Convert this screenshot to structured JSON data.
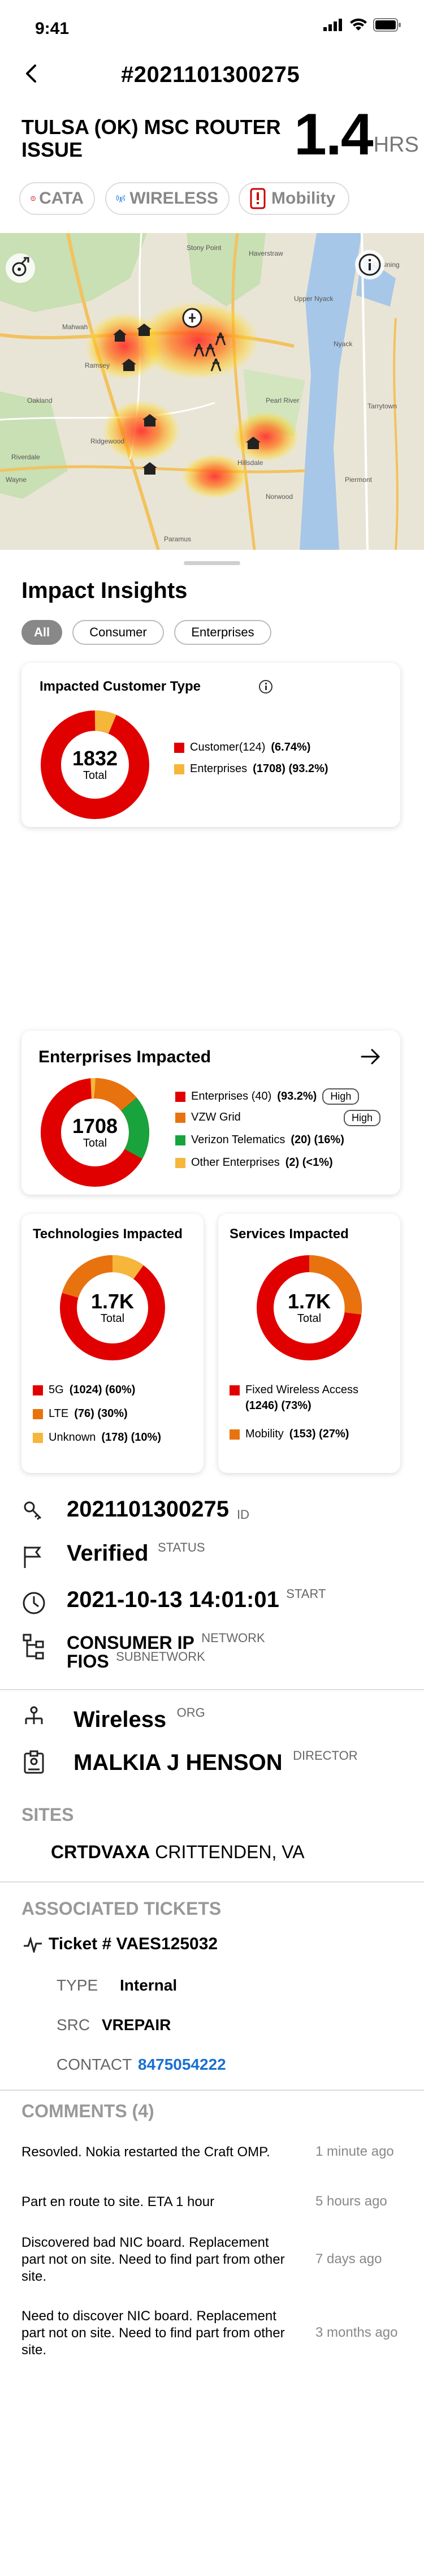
{
  "status_bar": {
    "time": "9:41"
  },
  "header": {
    "ticket_id": "#2021101300275"
  },
  "issue": {
    "title": "Tulsa (ok) MSC ROUTER ISSUE",
    "hours": "1.4",
    "hours_unit": "HRS"
  },
  "chips": [
    {
      "label": "CATA",
      "color": "#cc0000"
    },
    {
      "label": "WIRELESS",
      "color": "#1a73e8"
    },
    {
      "label": "Mobility",
      "color": "#cc0000"
    }
  ],
  "map": {
    "labels": [
      "Mahwah",
      "Ramsey",
      "Oakland",
      "Ridgewood",
      "Paramus",
      "Hillsdale",
      "Piermont",
      "Ossining",
      "Tarrytown",
      "Pearl River",
      "Nyack",
      "Wayne",
      "Riverdale",
      "Norwood",
      "Upper Nyack",
      "Haverstraw",
      "Stony Point"
    ]
  },
  "impact": {
    "title": "Impact Insights",
    "filters": [
      "All",
      "Consumer",
      "Enterprises"
    ],
    "customer_card": {
      "title": "Impacted Customer Type",
      "total": "1832",
      "total_label": "Total",
      "legend": [
        {
          "label": "Customer(124)",
          "value": "(6.74%)",
          "color": "#e00000"
        },
        {
          "label": "Enterprises",
          "value": "(1708) (93.2%)",
          "color": "#f5b63a"
        }
      ]
    },
    "enterprise_card": {
      "title": "Enterprises Impacted",
      "total": "1708",
      "total_label": "Total",
      "legend": [
        {
          "label": "Enterprises (40)",
          "value": "(93.2%)",
          "badge": "High",
          "color": "#e00000"
        },
        {
          "label": "VZW Grid",
          "value": "",
          "badge": "High",
          "color": "#e8730e"
        },
        {
          "label": "Verizon Telematics",
          "value": "(20) (16%)",
          "badge": "",
          "color": "#18a33c"
        },
        {
          "label": "Other Enterprises",
          "value": "(2) (<1%)",
          "badge": "",
          "color": "#f5b63a"
        }
      ]
    },
    "tech_card": {
      "title": "Technologies Impacted",
      "total": "1.7K",
      "total_label": "Total",
      "legend": [
        {
          "label": "5G",
          "value": "(1024) (60%)",
          "color": "#e00000"
        },
        {
          "label": "LTE",
          "value": "(76) (30%)",
          "color": "#e8730e"
        },
        {
          "label": "Unknown",
          "value": "(178) (10%)",
          "color": "#f5b63a"
        }
      ]
    },
    "services_card": {
      "title": "Services Impacted",
      "total": "1.7K",
      "total_label": "Total",
      "legend": [
        {
          "label": "Fixed Wireless Access",
          "value": "(1246) (73%)",
          "color": "#e00000"
        },
        {
          "label": "Mobility",
          "value": "(153) (27%)",
          "color": "#e8730e"
        }
      ]
    }
  },
  "details": {
    "id": "2021101300275",
    "id_label": "ID",
    "status": "Verified",
    "status_label": "STATUS",
    "start": "2021-10-13 14:01:01",
    "start_label": "START",
    "network": "CONSUMER IP",
    "network_label": "NETWORK",
    "subnetwork": "FIOS",
    "subnetwork_label": "SUBNETWORK",
    "org": "Wireless",
    "org_label": "ORG",
    "director": "MALKIA J HENSON",
    "director_label": "DIRECTOR"
  },
  "sites": {
    "heading": "SITES",
    "code": "CRTDVAXA",
    "location": "CRITTENDEN, VA"
  },
  "tickets": {
    "heading": "ASSOCIATED TICKETS",
    "ticket_label": "Ticket #",
    "ticket_number": "VAES125032",
    "type_label": "TYPE",
    "type_value": "Internal",
    "src_label": "SRC",
    "src_value": "VREPAIR",
    "contact_label": "CONTACT",
    "contact_value": "8475054222"
  },
  "comments": {
    "heading": "COMMENTS (4)",
    "items": [
      {
        "text": "Resovled. Nokia restarted the Craft OMP.",
        "time": "1 minute ago"
      },
      {
        "text": "Part en route to site. ETA 1 hour",
        "time": "5 hours ago"
      },
      {
        "text": "Discovered bad NIC board. Replacement part not on site. Need to find part from other site.",
        "time": "7 days ago"
      },
      {
        "text": "Need to discover NIC board. Replacement part not on site. Need to find part from other site.",
        "time": "3 months ago"
      }
    ]
  }
}
